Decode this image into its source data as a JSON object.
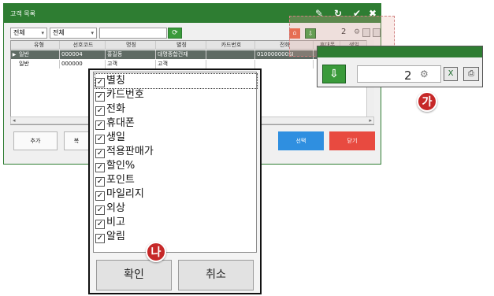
{
  "window": {
    "title": "고객 목록"
  },
  "filters": {
    "type_select": "전체",
    "group_select": "전체",
    "search_value": ""
  },
  "toolbar": {
    "count": "2"
  },
  "grid": {
    "columns": [
      "유형",
      "선호코드",
      "명칭",
      "별칭",
      "카드번호",
      "전화",
      "휴대폰",
      "생일"
    ],
    "rows": [
      [
        "일반",
        "000004",
        "홍길동",
        "대명종합건재",
        "",
        "010000000SI",
        "",
        ""
      ],
      [
        "일반",
        "000000",
        "고객",
        "고객",
        "",
        "",
        "",
        ""
      ]
    ]
  },
  "buttons": {
    "add": "추가",
    "copy": "복",
    "select": "선택",
    "close": "닫기"
  },
  "callout": {
    "badge_ga": "가",
    "badge_na": "나",
    "count": "2"
  },
  "column_popup": {
    "items": [
      "별칭",
      "카드번호",
      "전화",
      "휴대폰",
      "생일",
      "적용판매가",
      "할인%",
      "포인트",
      "마일리지",
      "외상",
      "비고",
      "알림"
    ],
    "confirm": "확인",
    "cancel": "취소"
  },
  "colors": {
    "title_green": "#2e7d32",
    "select_blue": "#2f8fe0",
    "close_red": "#e84a40",
    "badge_red": "#c62828"
  }
}
